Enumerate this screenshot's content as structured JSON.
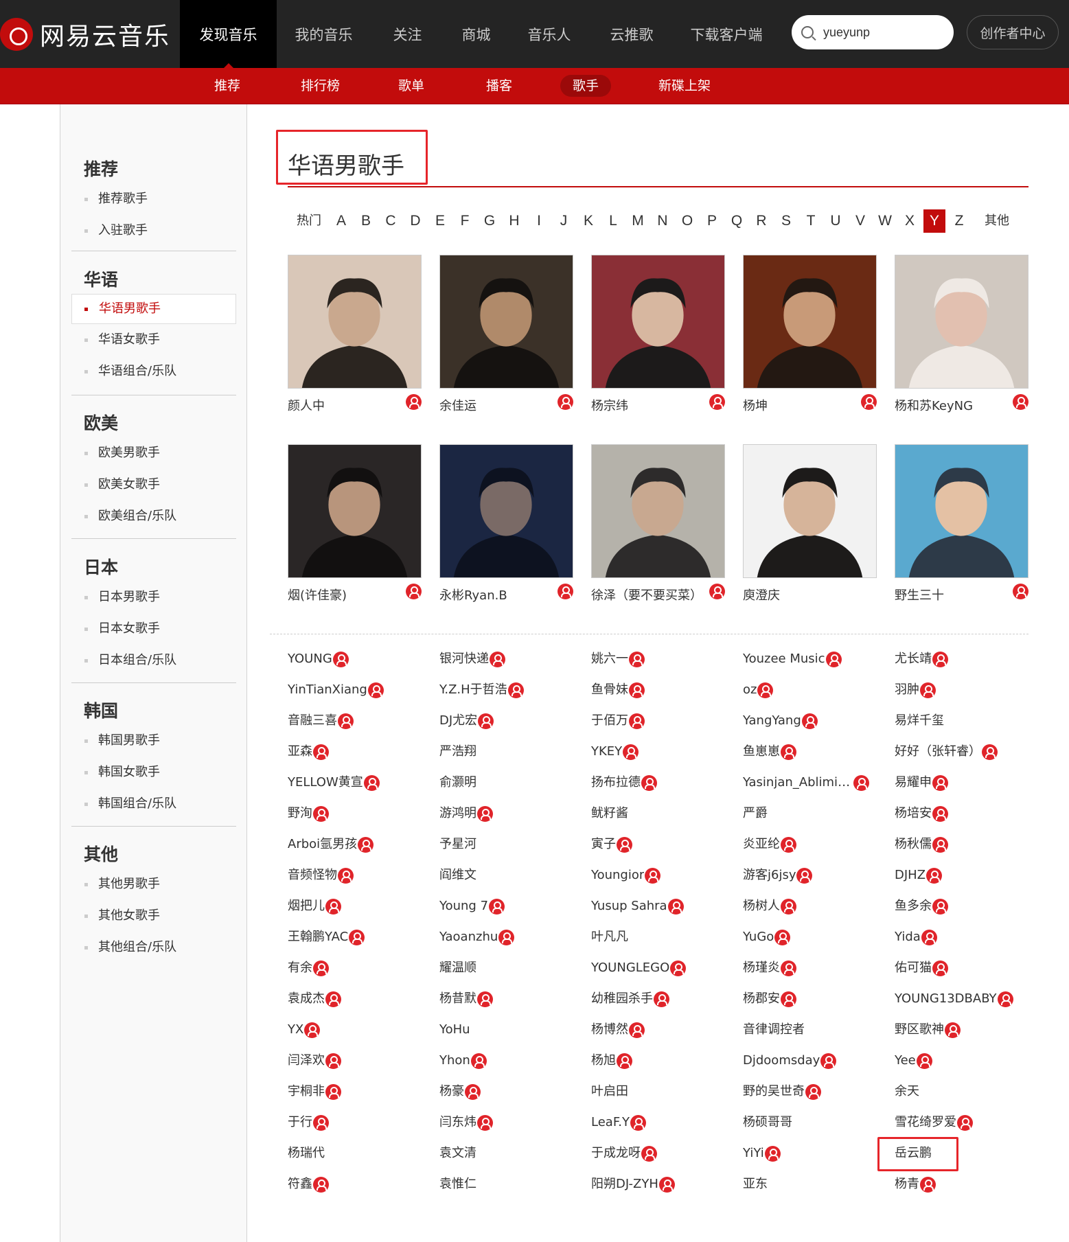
{
  "brand": "网易云音乐",
  "topnav": [
    "发现音乐",
    "我的音乐",
    "关注",
    "商城",
    "音乐人",
    "云推歌",
    "下载客户端"
  ],
  "search": {
    "value": "yueyunp"
  },
  "creator_center": "创作者中心",
  "subnav": [
    "推荐",
    "排行榜",
    "歌单",
    "播客",
    "歌手",
    "新碟上架"
  ],
  "sidebar": [
    {
      "title": "推荐",
      "items": [
        "推荐歌手",
        "入驻歌手"
      ]
    },
    {
      "title": "华语",
      "items": [
        "华语男歌手",
        "华语女歌手",
        "华语组合/乐队"
      ]
    },
    {
      "title": "欧美",
      "items": [
        "欧美男歌手",
        "欧美女歌手",
        "欧美组合/乐队"
      ]
    },
    {
      "title": "日本",
      "items": [
        "日本男歌手",
        "日本女歌手",
        "日本组合/乐队"
      ]
    },
    {
      "title": "韩国",
      "items": [
        "韩国男歌手",
        "韩国女歌手",
        "韩国组合/乐队"
      ]
    },
    {
      "title": "其他",
      "items": [
        "其他男歌手",
        "其他女歌手",
        "其他组合/乐队"
      ]
    }
  ],
  "sidebar_active": "华语男歌手",
  "page_title": "华语男歌手",
  "letters": [
    "热门",
    "A",
    "B",
    "C",
    "D",
    "E",
    "F",
    "G",
    "H",
    "I",
    "J",
    "K",
    "L",
    "M",
    "N",
    "O",
    "P",
    "Q",
    "R",
    "S",
    "T",
    "U",
    "V",
    "W",
    "X",
    "Y",
    "Z",
    "其他"
  ],
  "active_letter": "Y",
  "featured": [
    {
      "name": "颜人中",
      "badge": true
    },
    {
      "name": "余佳运",
      "badge": true
    },
    {
      "name": "杨宗纬",
      "badge": true
    },
    {
      "name": "杨坤",
      "badge": true
    },
    {
      "name": "杨和苏KeyNG",
      "badge": true
    },
    {
      "name": "烟(许佳豪)",
      "badge": true
    },
    {
      "name": "永彬Ryan.B",
      "badge": true
    },
    {
      "name": "徐泽（要不要买菜）",
      "badge": true
    },
    {
      "name": "庾澄庆",
      "badge": false
    },
    {
      "name": "野生三十",
      "badge": true
    }
  ],
  "artists": [
    [
      {
        "n": "YOUNG",
        "b": true
      },
      {
        "n": "YinTianXiang",
        "b": true
      },
      {
        "n": "音融三喜",
        "b": true
      },
      {
        "n": "亚森",
        "b": true
      },
      {
        "n": "YELLOW黄宣",
        "b": true
      },
      {
        "n": "野洵",
        "b": true
      },
      {
        "n": "Arboi氩男孩",
        "b": true
      },
      {
        "n": "音频怪物",
        "b": true
      },
      {
        "n": "烟把儿",
        "b": true
      },
      {
        "n": "王翰鹏YAC",
        "b": true
      },
      {
        "n": "有余",
        "b": true
      },
      {
        "n": "袁成杰",
        "b": true
      },
      {
        "n": "YX",
        "b": true
      },
      {
        "n": "闫泽欢",
        "b": true
      },
      {
        "n": "宇桐非",
        "b": true
      },
      {
        "n": "于行",
        "b": true
      },
      {
        "n": "杨瑞代",
        "b": false
      },
      {
        "n": "符鑫",
        "b": true
      }
    ],
    [
      {
        "n": "银河快递",
        "b": true
      },
      {
        "n": "Y.Z.H于哲浩",
        "b": true
      },
      {
        "n": "DJ尤宏",
        "b": true
      },
      {
        "n": "严浩翔",
        "b": false
      },
      {
        "n": "俞灏明",
        "b": false
      },
      {
        "n": "游鸿明",
        "b": true
      },
      {
        "n": "予星河",
        "b": false
      },
      {
        "n": "阎维文",
        "b": false
      },
      {
        "n": "Young 7",
        "b": true
      },
      {
        "n": "Yaoanzhu",
        "b": true
      },
      {
        "n": "耀温顺",
        "b": false
      },
      {
        "n": "杨昔默",
        "b": true
      },
      {
        "n": "YoHu",
        "b": false
      },
      {
        "n": "Yhon",
        "b": true
      },
      {
        "n": "杨豪",
        "b": true
      },
      {
        "n": "闫东炜",
        "b": true
      },
      {
        "n": "袁文清",
        "b": false
      },
      {
        "n": "袁惟仁",
        "b": false
      }
    ],
    [
      {
        "n": "姚六一",
        "b": true
      },
      {
        "n": "鱼骨妹",
        "b": true
      },
      {
        "n": "于佰万",
        "b": true
      },
      {
        "n": "YKEY",
        "b": true
      },
      {
        "n": "扬布拉德",
        "b": true
      },
      {
        "n": "鱿籽酱",
        "b": false
      },
      {
        "n": "寅子",
        "b": true
      },
      {
        "n": "Youngior",
        "b": true
      },
      {
        "n": "Yusup Sahra",
        "b": true
      },
      {
        "n": "叶凡凡",
        "b": false
      },
      {
        "n": "YOUNGLEGO",
        "b": true
      },
      {
        "n": "幼稚园杀手",
        "b": true
      },
      {
        "n": "杨博然",
        "b": true
      },
      {
        "n": "杨旭",
        "b": true
      },
      {
        "n": "叶启田",
        "b": false
      },
      {
        "n": "LeaF.Y",
        "b": true
      },
      {
        "n": "于成龙呀",
        "b": true
      },
      {
        "n": "阳朔DJ-ZYH",
        "b": true
      }
    ],
    [
      {
        "n": "Youzee Music",
        "b": true
      },
      {
        "n": "oz",
        "b": true
      },
      {
        "n": "YangYang",
        "b": true
      },
      {
        "n": "鱼崽崽",
        "b": true
      },
      {
        "n": "Yasinjan_Ablimit ...",
        "b": true
      },
      {
        "n": "严爵",
        "b": false
      },
      {
        "n": "炎亚纶",
        "b": true
      },
      {
        "n": "游客j6jsy",
        "b": true
      },
      {
        "n": "杨树人",
        "b": true
      },
      {
        "n": "YuGo",
        "b": true
      },
      {
        "n": "杨瑾炎",
        "b": true
      },
      {
        "n": "杨郡安",
        "b": true
      },
      {
        "n": "音律调控者",
        "b": false
      },
      {
        "n": "Djdoomsday",
        "b": true
      },
      {
        "n": "野的吴世奇",
        "b": true
      },
      {
        "n": "杨硕哥哥",
        "b": false
      },
      {
        "n": "YiYi",
        "b": true
      },
      {
        "n": "亚东",
        "b": false
      }
    ],
    [
      {
        "n": "尤长靖",
        "b": true
      },
      {
        "n": "羽肿",
        "b": true
      },
      {
        "n": "易烊千玺",
        "b": false
      },
      {
        "n": "好好（张轩睿）",
        "b": true
      },
      {
        "n": "易耀申",
        "b": true
      },
      {
        "n": "杨培安",
        "b": true
      },
      {
        "n": "杨秋儒",
        "b": true
      },
      {
        "n": "DJHZ",
        "b": true
      },
      {
        "n": "鱼多余",
        "b": true
      },
      {
        "n": "Yida",
        "b": true
      },
      {
        "n": "佑可猫",
        "b": true
      },
      {
        "n": "YOUNG13DBABY",
        "b": true
      },
      {
        "n": "野区歌神",
        "b": true
      },
      {
        "n": "Yee",
        "b": true
      },
      {
        "n": "余天",
        "b": false
      },
      {
        "n": "雪花绮罗爱",
        "b": true
      },
      {
        "n": "岳云鹏",
        "b": false
      },
      {
        "n": "杨青",
        "b": true
      }
    ]
  ],
  "highlighted_artist": "岳云鹏"
}
